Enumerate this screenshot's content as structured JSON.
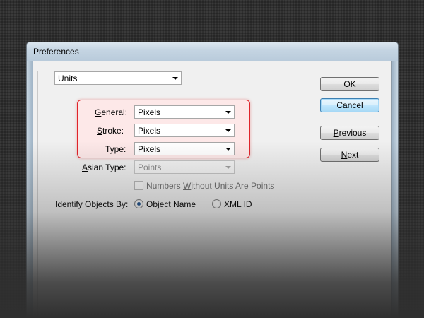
{
  "window": {
    "title": "Preferences"
  },
  "section": {
    "selected": "Units"
  },
  "units": {
    "general": {
      "label_u": "G",
      "label_rest": "eneral:",
      "value": "Pixels"
    },
    "stroke": {
      "label_u": "S",
      "label_rest": "troke:",
      "value": "Pixels"
    },
    "type": {
      "label_u": "T",
      "label_rest": "ype:",
      "value": "Pixels"
    },
    "asian_type": {
      "label_pre": "A",
      "label_rest": "sian Type:",
      "value": "Points"
    }
  },
  "numbers_without_units": {
    "label_pre": "Numbers ",
    "label_u": "W",
    "label_rest": "ithout Units Are Points",
    "checked": false
  },
  "identify": {
    "label": "Identify Objects By:",
    "object_name": {
      "label_u": "O",
      "label_rest": "bject Name",
      "selected": true
    },
    "xml_id": {
      "label_u": "X",
      "label_rest": "ML ID",
      "selected": false
    }
  },
  "buttons": {
    "ok": "OK",
    "cancel": "Cancel",
    "previous_u": "P",
    "previous_rest": "revious",
    "next_u": "N",
    "next_rest": "ext"
  },
  "colors": {
    "highlight_border": "#e0242a",
    "default_button": "#3c7fb1",
    "background": "#2f2f2f"
  }
}
